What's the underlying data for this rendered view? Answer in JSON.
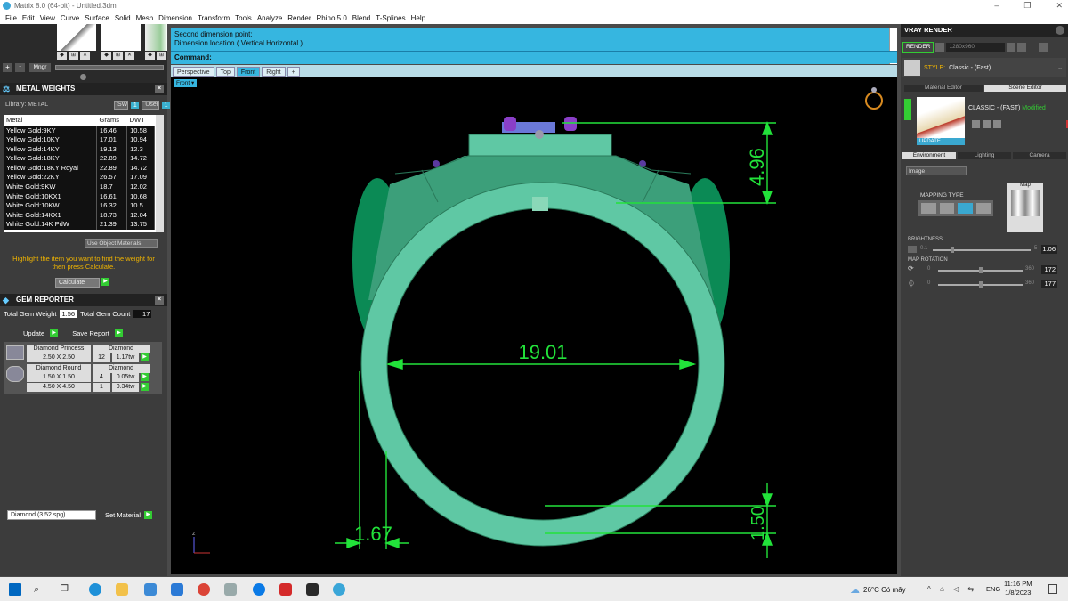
{
  "window": {
    "title": "Matrix 8.0 (64-bit) - Untitled.3dm",
    "minimize": "–",
    "maximize": "❐",
    "close": "✕"
  },
  "menu": [
    "File",
    "Edit",
    "View",
    "Curve",
    "Surface",
    "Solid",
    "Mesh",
    "Dimension",
    "Transform",
    "Tools",
    "Analyze",
    "Render",
    "Rhino 5.0",
    "Blend",
    "T-Splines",
    "Help"
  ],
  "toolbar_left": {
    "plus": "+",
    "arrow": "↑",
    "mngr": "Mngr"
  },
  "metal_weights": {
    "title": "METAL WEIGHTS",
    "library_label": "Library: METAL",
    "sw_label": "SW",
    "sw_value": "1",
    "user_label": "User",
    "user_value": "1",
    "columns": [
      "Metal",
      "Grams",
      "DWT"
    ],
    "rows": [
      [
        "Yellow Gold:9KY",
        "16.46",
        "10.58"
      ],
      [
        "Yellow Gold:10KY",
        "17.01",
        "10.94"
      ],
      [
        "Yellow Gold:14KY",
        "19.13",
        "12.3"
      ],
      [
        "Yellow Gold:18KY",
        "22.89",
        "14.72"
      ],
      [
        "Yellow Gold:18KY Royal",
        "22.89",
        "14.72"
      ],
      [
        "Yellow Gold:22KY",
        "26.57",
        "17.09"
      ],
      [
        "White Gold:9KW",
        "18.7",
        "12.02"
      ],
      [
        "White Gold:10KX1",
        "16.61",
        "10.68"
      ],
      [
        "White Gold:10KW",
        "16.32",
        "10.5"
      ],
      [
        "White Gold:14KX1",
        "18.73",
        "12.04"
      ],
      [
        "White Gold:14K PdW",
        "21.39",
        "13.75"
      ]
    ],
    "use_object_materials": "Use Object Materials",
    "instruction": "Highlight the item you want to find the weight for then press Calculate.",
    "calculate": "Calculate"
  },
  "gem_reporter": {
    "title": "GEM REPORTER",
    "total_weight_label": "Total Gem Weight",
    "total_weight_value": "1.56",
    "total_count_label": "Total Gem Count",
    "total_count_value": "17",
    "update": "Update",
    "save_report": "Save Report",
    "groups": [
      {
        "name": "Diamond Princess",
        "material": "Diamond",
        "size": "2.50 X 2.50",
        "count": "12",
        "weight": "1.17tw"
      },
      {
        "name": "Diamond Round",
        "material": "Diamond",
        "size": "1.50 X 1.50",
        "count": "4",
        "weight": "0.05tw"
      },
      {
        "name": "",
        "material": "",
        "size": "4.50 X 4.50",
        "count": "1",
        "weight": "0.34tw"
      }
    ],
    "material_select": "Diamond    (3.52 spg)",
    "set_material": "Set Material"
  },
  "command": {
    "line1": "Second dimension point:",
    "line2": "Dimension location ( Vertical  Horizontal )",
    "prompt": "Command:"
  },
  "viewport_tabs": [
    "Perspective",
    "Top",
    "Front",
    "Right",
    "+"
  ],
  "active_view": "Front",
  "viewport_label": "Front",
  "dimensions": {
    "top": "4.96",
    "width": "19.01",
    "side": "1.67",
    "bottom": "1.50"
  },
  "axis_label": "z",
  "vray": {
    "title": "VRAY RENDER",
    "render": "RENDER",
    "resolution": "1280x960",
    "style_label": "STYLE:",
    "style_value": "Classic - (Fast)",
    "tabs": [
      "Material Editor",
      "Scene Editor"
    ],
    "preset_name": "CLASSIC - (FAST)",
    "modified": "Modified",
    "update": "UPDATE",
    "env_tabs": [
      "Environment",
      "Lighting",
      "Camera"
    ],
    "env_select": "Image",
    "mapping_type": "MAPPING TYPE",
    "map_label": "Map",
    "brightness_label": "BRIGHTNESS",
    "brightness_min": "0.1",
    "brightness_max": "5",
    "brightness_value": "1.06",
    "map_rotation_label": "MAP ROTATION",
    "rot1_min": "0",
    "rot1_max": "360",
    "rot1_value": "172",
    "rot2_min": "0",
    "rot2_max": "360",
    "rot2_value": "177"
  },
  "taskbar": {
    "weather": "26°C  Có mây",
    "lang": "ENG",
    "time": "11:16 PM",
    "date": "1/8/2023"
  },
  "colors": {
    "accent": "#36b6e0",
    "model": "#5fc8a4",
    "dimension": "#22e23a",
    "gem": "#7a3fc0"
  }
}
